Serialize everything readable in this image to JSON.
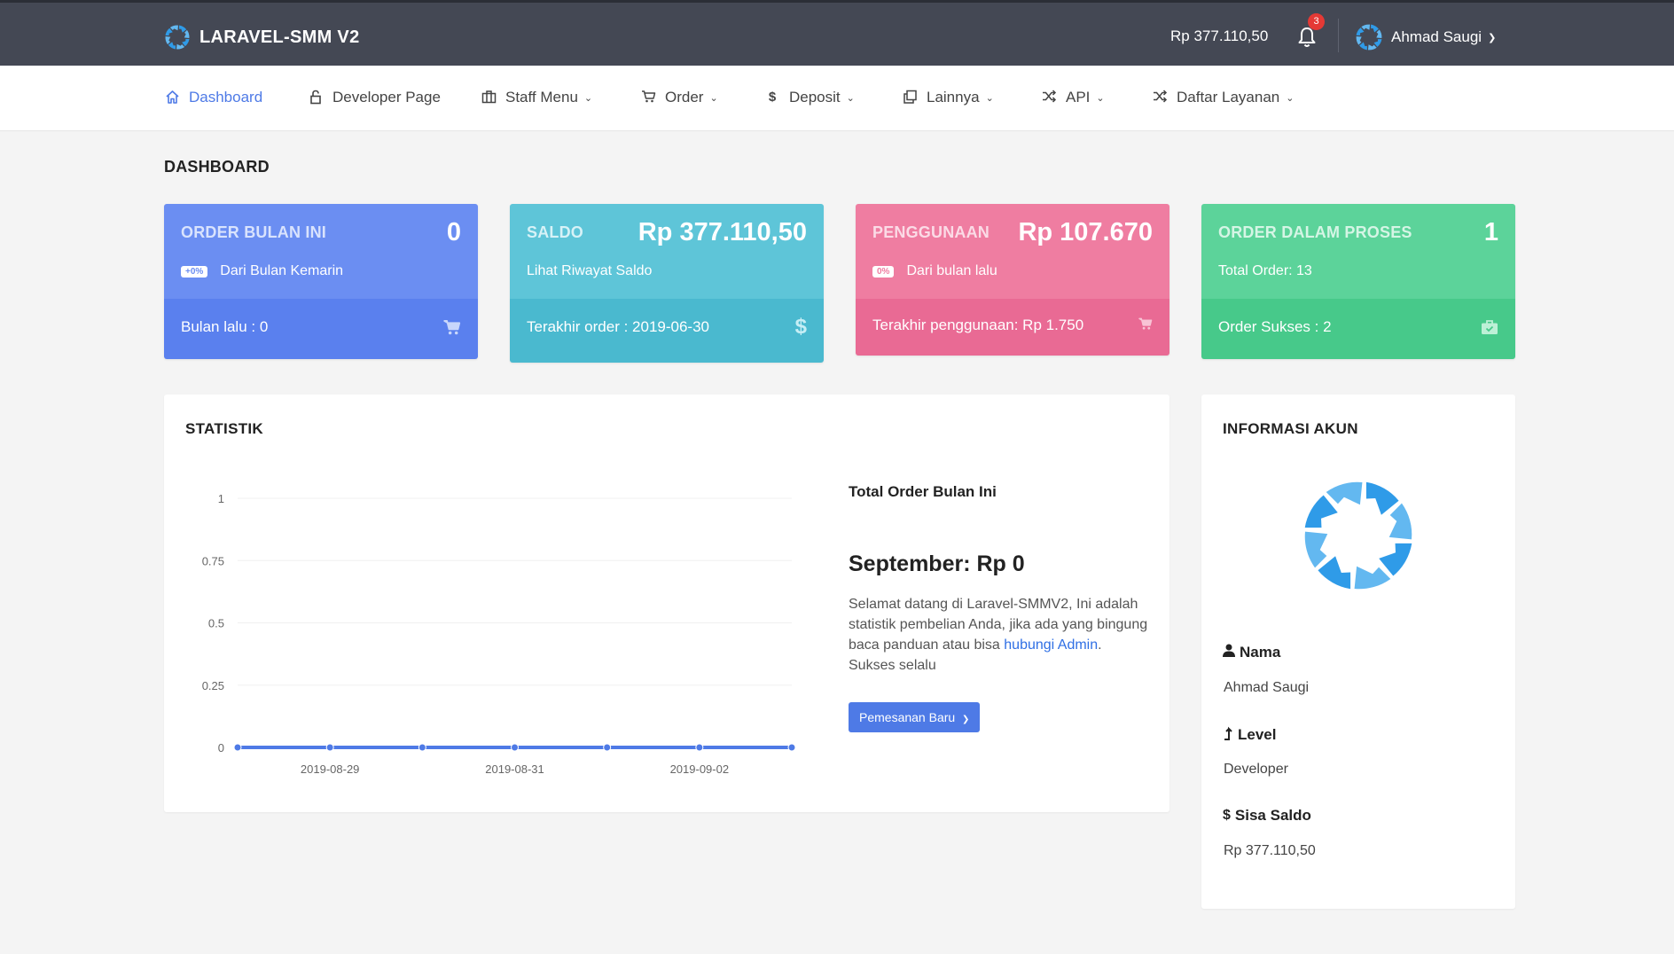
{
  "brand": {
    "name": "LARAVEL-SMM V2",
    "logo_icon": "pinwheel-logo-icon"
  },
  "topbar": {
    "saldo": "Rp 377.110,50",
    "notification_count": "3",
    "user_name": "Ahmad Saugi"
  },
  "nav": {
    "items": [
      {
        "label": "Dashboard",
        "icon": "home-icon"
      },
      {
        "label": "Developer Page",
        "icon": "lock-icon"
      },
      {
        "label": "Staff Menu",
        "icon": "briefcase-icon"
      },
      {
        "label": "Order",
        "icon": "cart-icon"
      },
      {
        "label": "Deposit",
        "icon": "dollar-icon"
      },
      {
        "label": "Lainnya",
        "icon": "copy-icon"
      },
      {
        "label": "API",
        "icon": "shuffle-icon"
      },
      {
        "label": "Daftar Layanan",
        "icon": "shuffle-icon"
      }
    ]
  },
  "page": {
    "title": "DASHBOARD"
  },
  "cards": [
    {
      "label": "ORDER BULAN INI",
      "value": "0",
      "pill": "+0%",
      "sub": "Dari Bulan Kemarin",
      "footer": "Bulan lalu : 0",
      "icon": "cart-icon",
      "color": "#6b8ef2"
    },
    {
      "label": "SALDO",
      "value": "Rp 377.110,50",
      "sub": "Lihat Riwayat Saldo",
      "footer": "Terakhir order : 2019-06-30",
      "icon": "dollar-icon",
      "color": "#5ec5d8"
    },
    {
      "label": "PENGGUNAAN",
      "value": "Rp 107.670",
      "pill": "0%",
      "sub": "Dari bulan lalu",
      "footer": "Terakhir penggunaan: Rp 1.750",
      "icon": "cart-icon",
      "color": "#ef7da1"
    },
    {
      "label": "ORDER DALAM PROSES",
      "value": "1",
      "sub": "Total Order: 13",
      "footer": "Order Sukses : 2",
      "icon": "briefcase-icon",
      "color": "#5cd39a"
    }
  ],
  "statistik": {
    "title": "STATISTIK",
    "heading": "Total Order Bulan Ini",
    "big": "September: Rp 0",
    "text_before": "Selamat datang di Laravel-SMMV2, Ini adalah statistik pembelian Anda, jika ada yang bingung baca panduan atau bisa ",
    "link": "hubungi Admin",
    "text_after": ". Sukses selalu",
    "button": "Pemesanan Baru"
  },
  "chart_data": {
    "type": "line",
    "x": [
      "2019-08-28",
      "2019-08-29",
      "2019-08-30",
      "2019-08-31",
      "2019-09-01",
      "2019-09-02",
      "2019-09-03"
    ],
    "x_tick_labels": [
      "2019-08-29",
      "2019-08-31",
      "2019-09-02"
    ],
    "y_tick_labels": [
      "0",
      "0.25",
      "0.5",
      "0.75",
      "1"
    ],
    "series": [
      {
        "values": [
          0,
          0,
          0,
          0,
          0,
          0,
          0
        ],
        "color": "#4e7ae6"
      }
    ],
    "ylim": [
      0,
      1
    ],
    "grid": true
  },
  "account": {
    "title": "INFORMASI AKUN",
    "fields": [
      {
        "label": "Nama",
        "value": "Ahmad Saugi",
        "icon": "user-icon"
      },
      {
        "label": "Level",
        "value": "Developer",
        "icon": "level-up-icon"
      },
      {
        "label": "Sisa Saldo",
        "value": "Rp 377.110,50",
        "icon": "dollar-icon"
      }
    ]
  }
}
